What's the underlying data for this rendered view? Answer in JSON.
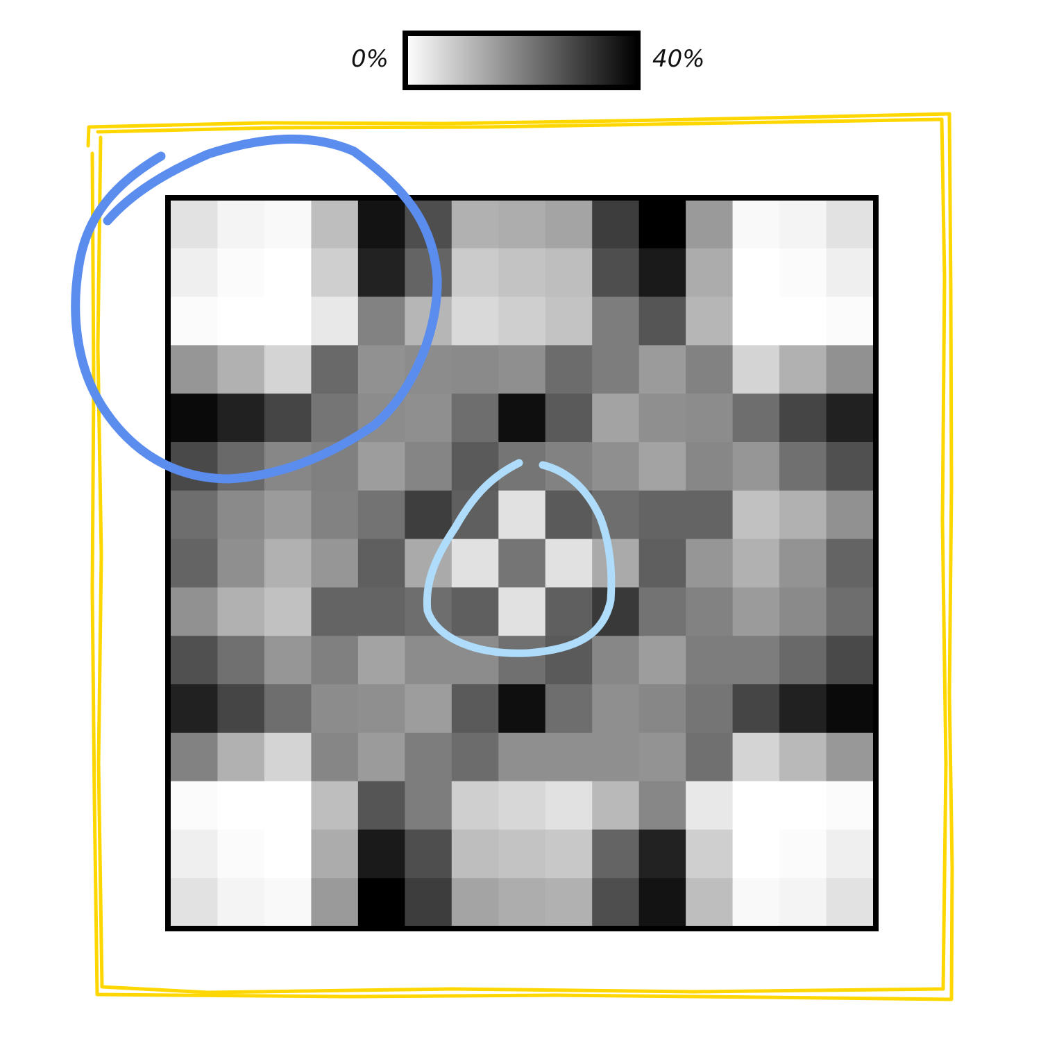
{
  "colorbar": {
    "min_label": "0%",
    "max_label": "40%",
    "colormap": "white-to-black"
  },
  "annotations": [
    {
      "kind": "rectangle",
      "color": "#FFD700"
    },
    {
      "kind": "circle",
      "color": "#5B8DEF"
    },
    {
      "kind": "circle",
      "color": "#AEDCFA"
    }
  ],
  "chart_data": {
    "type": "heatmap",
    "rows": 15,
    "cols": 15,
    "value_range": [
      0,
      40
    ],
    "unit": "%",
    "values": [
      [
        4.5,
        1.8,
        0.9,
        10.2,
        37.0,
        27.8,
        12.2,
        12.8,
        14.2,
        30.5,
        40.0,
        15.8,
        0.9,
        1.8,
        4.5
      ],
      [
        2.5,
        0.6,
        0.0,
        7.5,
        34.7,
        24.3,
        8.2,
        9.4,
        10.2,
        27.8,
        35.9,
        13.0,
        0.0,
        0.6,
        2.5
      ],
      [
        0.7,
        0.0,
        0.0,
        3.6,
        19.6,
        11.4,
        5.9,
        7.5,
        9.4,
        20.4,
        26.6,
        11.4,
        0.0,
        0.0,
        0.7
      ],
      [
        16.5,
        12.2,
        6.7,
        23.5,
        17.2,
        18.0,
        18.4,
        17.6,
        23.1,
        20.4,
        15.7,
        19.6,
        6.7,
        12.2,
        17.2
      ],
      [
        38.4,
        34.9,
        29.2,
        21.6,
        18.0,
        17.6,
        22.7,
        37.6,
        25.9,
        14.5,
        17.6,
        18.0,
        22.7,
        29.2,
        34.9
      ],
      [
        28.6,
        23.5,
        18.8,
        20.0,
        15.3,
        19.2,
        25.9,
        21.6,
        19.6,
        17.6,
        14.5,
        18.8,
        16.5,
        22.4,
        27.5
      ],
      [
        22.7,
        18.4,
        15.7,
        19.6,
        22.0,
        30.2,
        25.1,
        4.7,
        25.9,
        22.7,
        24.3,
        24.3,
        9.8,
        12.2,
        17.3
      ],
      [
        24.3,
        17.6,
        12.2,
        16.5,
        25.1,
        13.3,
        4.7,
        21.6,
        4.7,
        13.3,
        25.1,
        16.5,
        12.2,
        16.9,
        24.3
      ],
      [
        17.3,
        12.2,
        9.8,
        24.3,
        24.3,
        22.7,
        25.1,
        4.7,
        25.1,
        31.0,
        22.0,
        19.6,
        15.7,
        18.4,
        22.7
      ],
      [
        27.5,
        22.4,
        16.5,
        20.0,
        14.5,
        18.0,
        18.0,
        22.4,
        25.9,
        18.8,
        15.3,
        20.4,
        20.4,
        23.5,
        28.6
      ],
      [
        34.9,
        29.2,
        22.7,
        18.0,
        17.6,
        15.3,
        25.9,
        37.6,
        22.7,
        17.6,
        18.8,
        21.6,
        29.2,
        34.9,
        38.4
      ],
      [
        19.6,
        12.2,
        6.7,
        19.0,
        15.7,
        20.4,
        23.1,
        17.6,
        17.6,
        17.6,
        16.9,
        22.4,
        6.7,
        11.0,
        16.1
      ],
      [
        0.7,
        0.0,
        0.0,
        10.2,
        26.6,
        20.4,
        7.5,
        6.3,
        4.7,
        11.0,
        18.8,
        3.6,
        0.0,
        0.0,
        0.7
      ],
      [
        2.5,
        0.6,
        0.0,
        13.0,
        35.9,
        27.8,
        10.2,
        9.4,
        8.6,
        24.3,
        34.7,
        7.5,
        0.0,
        0.6,
        2.5
      ],
      [
        4.5,
        1.8,
        0.9,
        15.8,
        40.0,
        30.5,
        14.2,
        12.8,
        12.2,
        27.8,
        37.0,
        10.2,
        0.9,
        1.8,
        4.5
      ]
    ]
  }
}
